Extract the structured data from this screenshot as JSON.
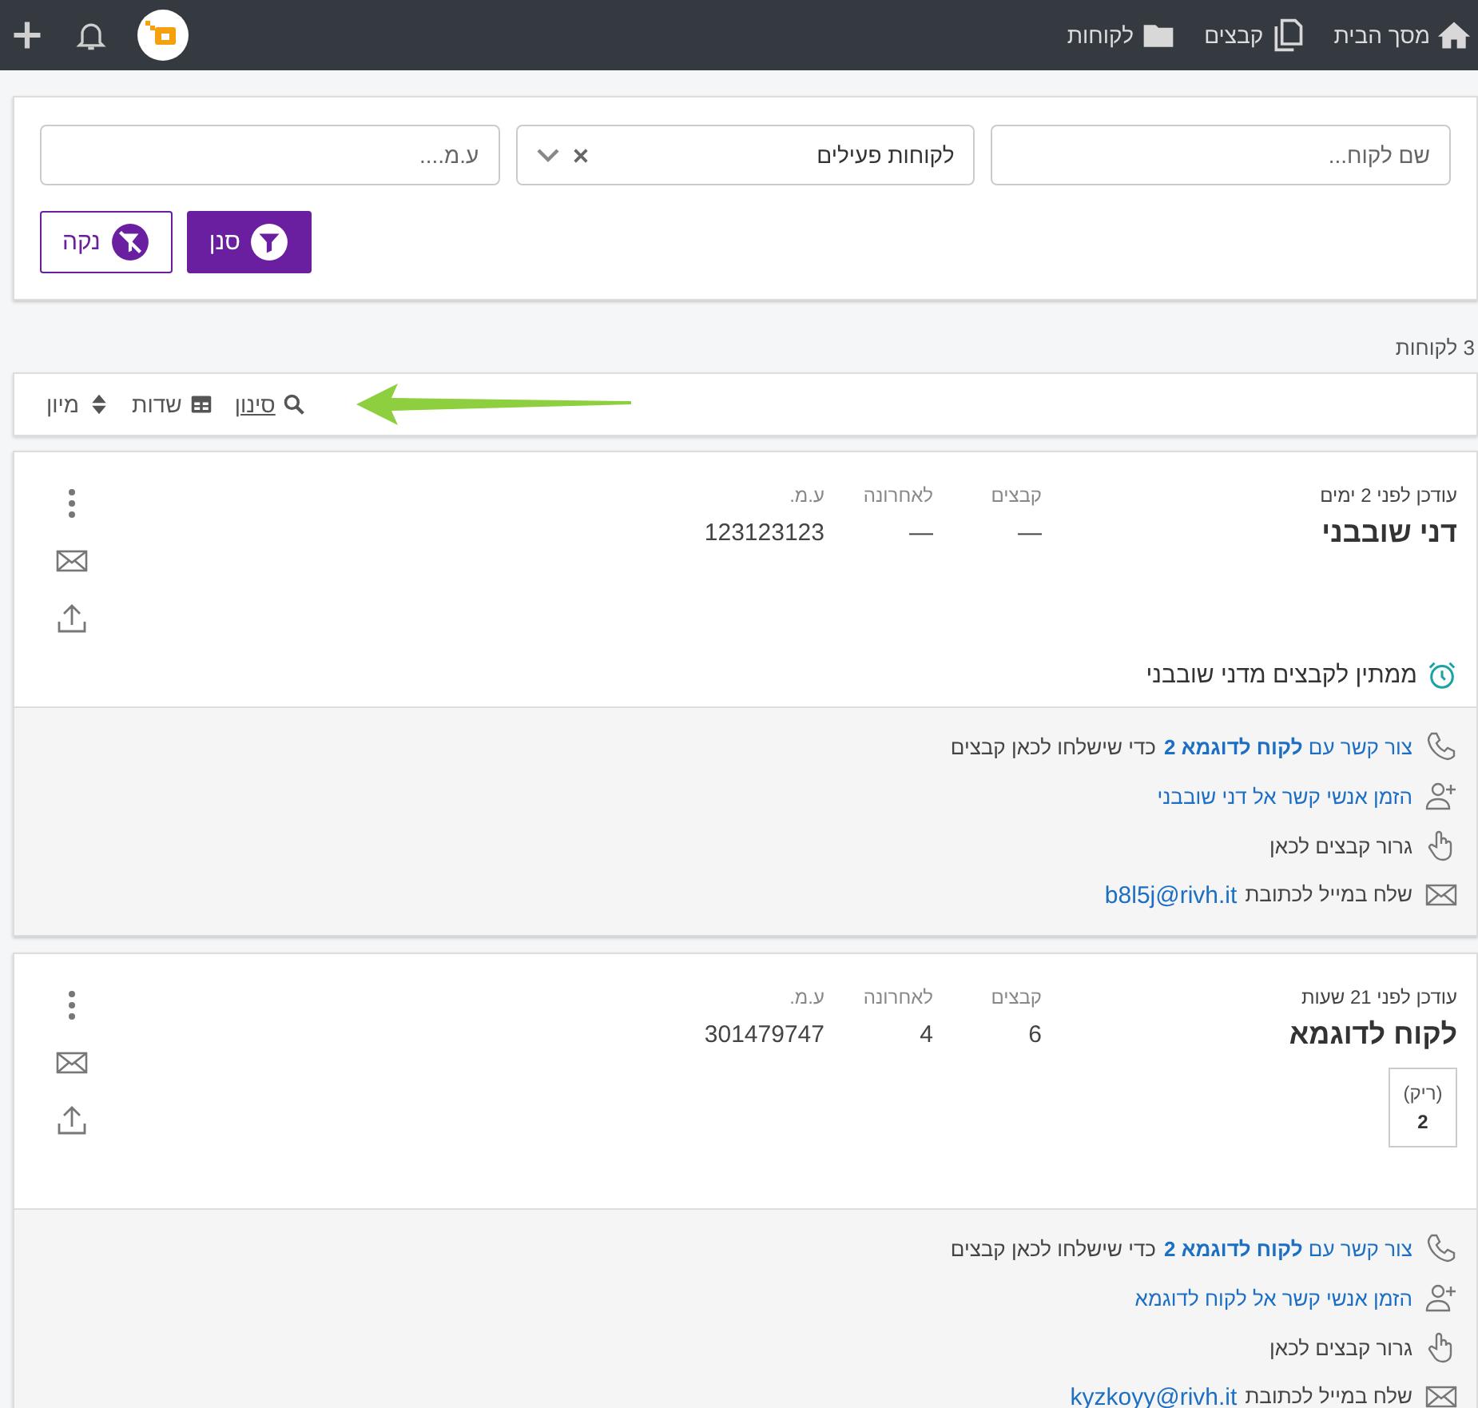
{
  "topbar": {
    "nav": [
      {
        "label": "מסך הבית",
        "kind": "home"
      },
      {
        "label": "קבצים",
        "kind": "files"
      },
      {
        "label": "לקוחות",
        "kind": "folder"
      }
    ]
  },
  "filters": {
    "name_field": {
      "placeholder": "שם לקוח..."
    },
    "status_select": {
      "value": "לקוחות פעילים"
    },
    "id_field": {
      "placeholder": "ע.מ...."
    },
    "buttons": [
      {
        "label": "סנן",
        "kind": "primary"
      },
      {
        "label": "נקה",
        "kind": "secondary"
      }
    ]
  },
  "count": "3 לקוחות",
  "toolbar": [
    {
      "label": "סינון",
      "kind": "filter"
    },
    {
      "label": "שדות",
      "kind": "fields"
    },
    {
      "label": "מיון",
      "kind": "sort"
    }
  ],
  "customers": [
    {
      "updated": "עודכן לפני 2 ימים",
      "name": "דני שובבני",
      "stats": [
        {
          "label": "קבצים",
          "value": "—"
        },
        {
          "label": "לאחרונה",
          "value": "—"
        },
        {
          "label": "ע.מ.",
          "value": "123123123"
        }
      ],
      "waiting": "ממתין לקבצים מדני שובבני",
      "contacts": [
        {
          "kind": "phone",
          "parts": [
            {
              "text": "צור קשר עם **לקוח לדוגמא 2**",
              "link": true
            },
            {
              "text": "כדי שישלחו לכאן קבצים",
              "link": false
            }
          ]
        },
        {
          "kind": "invite",
          "parts": [
            {
              "text": "הזמן אנשי קשר אל דני שובבני",
              "link": true
            }
          ]
        },
        {
          "kind": "drag",
          "parts": [
            {
              "text": "גרור קבצים לכאן",
              "link": false
            }
          ]
        },
        {
          "kind": "email",
          "parts": [
            {
              "text": "שלח במייל לכתובת",
              "link": false
            },
            {
              "text": "b8l5j@rivh.it",
              "link": true
            }
          ]
        }
      ]
    },
    {
      "updated": "עודכן לפני 21 שעות",
      "name": "לקוח לדוגמא",
      "stats": [
        {
          "label": "קבצים",
          "value": "6"
        },
        {
          "label": "לאחרונה",
          "value": "4"
        },
        {
          "label": "ע.מ.",
          "value": "301479747"
        }
      ],
      "tiles": [
        {
          "label": "(ריק)",
          "value": "2"
        }
      ],
      "contacts": [
        {
          "kind": "phone",
          "parts": [
            {
              "text": "צור קשר עם **לקוח לדוגמא 2**",
              "link": true
            },
            {
              "text": "כדי שישלחו לכאן קבצים",
              "link": false
            }
          ]
        },
        {
          "kind": "invite",
          "parts": [
            {
              "text": "הזמן אנשי קשר אל לקוח לדוגמא",
              "link": true
            }
          ]
        },
        {
          "kind": "drag",
          "parts": [
            {
              "text": "גרור קבצים לכאן",
              "link": false
            }
          ]
        },
        {
          "kind": "email",
          "parts": [
            {
              "text": "שלח במייל לכתובת",
              "link": false
            },
            {
              "text": "kyzkoyy@rivh.it",
              "link": true
            }
          ]
        }
      ]
    }
  ]
}
